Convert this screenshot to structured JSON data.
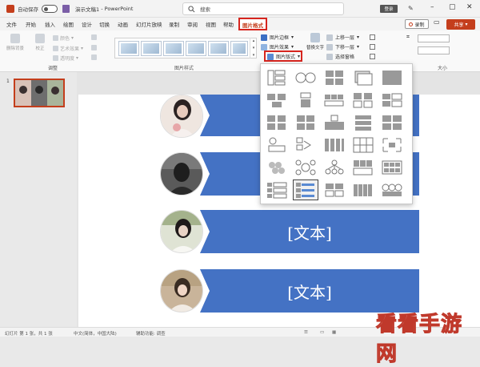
{
  "titlebar": {
    "autosave_label": "自动保存",
    "toggle_state": "off",
    "document_name": "演示文稿1",
    "app_name": "PowerPoint",
    "search_placeholder": "搜索",
    "login_label": "登录"
  },
  "tabs": [
    "文件",
    "开始",
    "插入",
    "绘图",
    "设计",
    "切换",
    "动画",
    "幻灯片放映",
    "录制",
    "审阅",
    "视图",
    "帮助",
    "图片格式"
  ],
  "active_tab": "图片格式",
  "actions": {
    "record_label": "录制",
    "share_label": "共享"
  },
  "ribbon": {
    "adjust": {
      "remove_bg": "删除背景",
      "corrections": "校正",
      "color": "颜色",
      "artistic": "艺术效果",
      "transparency": "透明度",
      "label": "调整"
    },
    "picture_styles_label": "图片样式",
    "border": "图片边框",
    "effects": "图片效果",
    "layout": "图片版式",
    "alt_text": "替换文字",
    "bring_forward": "上移一层",
    "send_backward": "下移一层",
    "selection_pane": "选择窗格",
    "size_label": "大小"
  },
  "slide_panel": {
    "slide_number": "1"
  },
  "slide": {
    "text_placeholder": "[文本]"
  },
  "statusbar": {
    "slide_info": "幻灯片 第 1 张，共 1 张",
    "language": "中文(简体，中国大陆)",
    "accessibility": "辅助功能: 调查"
  },
  "watermark": "看看手游网",
  "colors": {
    "accent": "#c43e1c",
    "band": "#4472c4",
    "highlight": "#d6251e"
  }
}
